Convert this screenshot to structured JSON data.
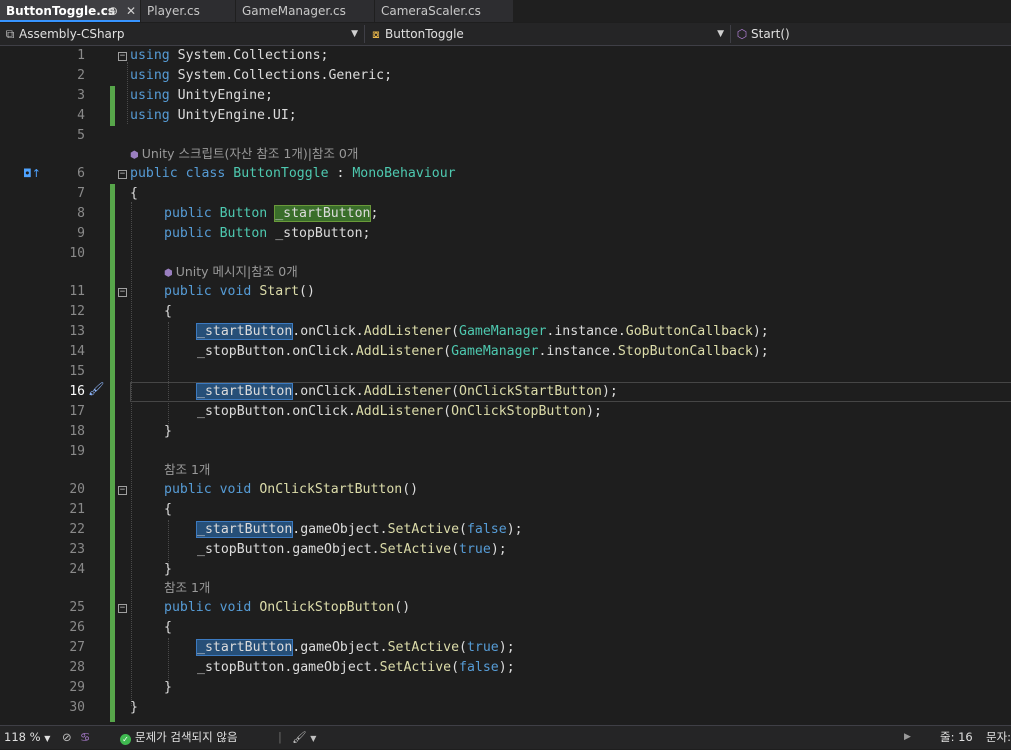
{
  "tabs": [
    {
      "label": "ButtonToggle.cs",
      "active": true
    },
    {
      "label": "Player.cs"
    },
    {
      "label": "GameManager.cs"
    },
    {
      "label": "CameraScaler.cs"
    }
  ],
  "tab_pin": "⊕",
  "tab_close": "✕",
  "nav": {
    "project": "Assembly-CSharp",
    "class": "ButtonToggle",
    "member": "Start()"
  },
  "codelens": {
    "class_refs": "Unity 스크립트(자산 참조 1개)|참조 0개",
    "unity_message": "Unity 메시지|참조 0개",
    "refs_1": "참조 1개"
  },
  "line_numbers": [
    "1",
    "2",
    "3",
    "4",
    "5",
    "6",
    "7",
    "8",
    "9",
    "10",
    "11",
    "12",
    "13",
    "14",
    "15",
    "16",
    "17",
    "18",
    "19",
    "20",
    "21",
    "22",
    "23",
    "24",
    "25",
    "26",
    "27",
    "28",
    "29",
    "30"
  ],
  "current_line": "16",
  "code": {
    "l1_kw": "using",
    "l1_rest": " System.Collections;",
    "l2_kw": "using",
    "l2_rest": " System.Collections.Generic;",
    "l3_kw": "using",
    "l3_rest": " UnityEngine;",
    "l4_kw": "using",
    "l4_rest": " UnityEngine.UI;",
    "l6_kw1": "public",
    "l6_kw2": "class",
    "l6_name": "ButtonToggle",
    "l6_colon": " : ",
    "l6_base": "MonoBehaviour",
    "brace_open": "{",
    "brace_close": "}",
    "public": "public",
    "void": "void",
    "Button": "Button",
    "startButton": "_startButton",
    "stopButton": "_stopButton",
    "semi": ";",
    "start_fn": "Start",
    "parens": "()",
    "onclick": ".onClick.",
    "add_listener": "AddListener",
    "open_paren": "(",
    "close_paren_semi": ");",
    "game_manager": "GameManager",
    "instance_dot": ".instance.",
    "go_cb": "GoButtonCallback",
    "stop_cb": "StopButonCallback",
    "on_start": "OnClickStartButton",
    "on_stop": "OnClickStopButton",
    "game_object": ".gameObject.",
    "set_active": "SetActive",
    "false": "false",
    "true": "true"
  },
  "status": {
    "zoom": "118 %",
    "issues": "문제가 검색되지 않음",
    "line": "줄: 16",
    "char": "문자:"
  }
}
